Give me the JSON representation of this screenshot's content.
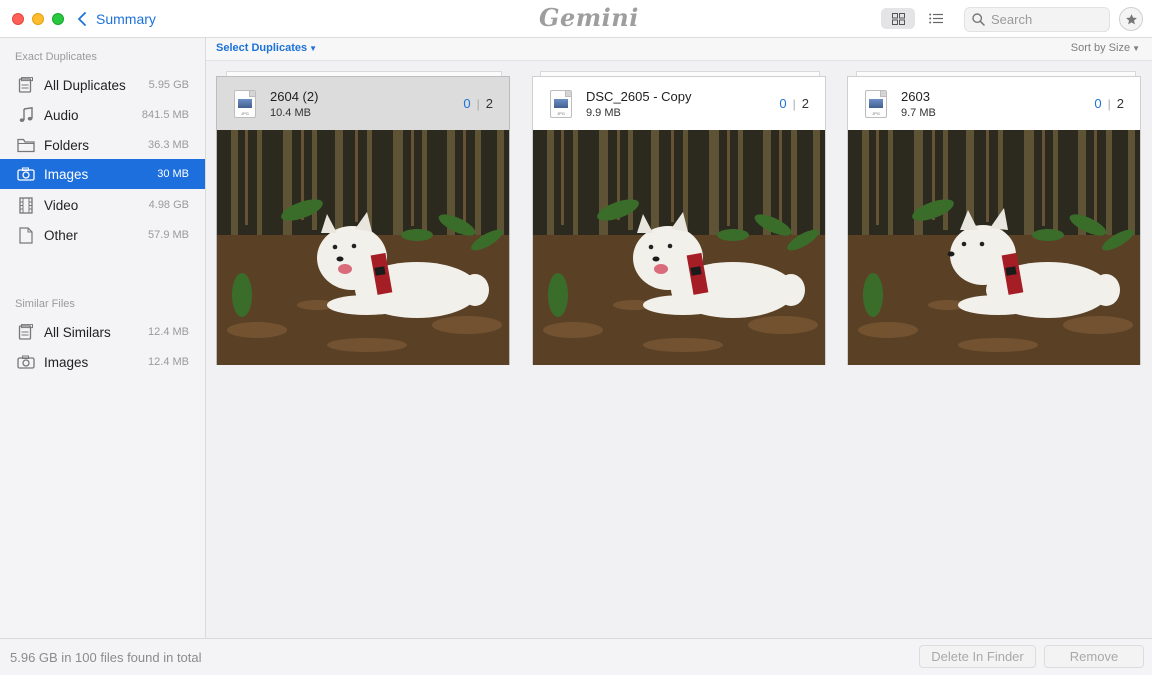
{
  "window": {
    "back_label": "Summary",
    "logo_text": "Gemini",
    "search_placeholder": "Search"
  },
  "sidebar": {
    "exact_title": "Exact Duplicates",
    "exact_items": [
      {
        "label": "All Duplicates",
        "size": "5.95 GB",
        "icon": "duplicates-icon"
      },
      {
        "label": "Audio",
        "size": "841.5 MB",
        "icon": "music-note-icon"
      },
      {
        "label": "Folders",
        "size": "36.3 MB",
        "icon": "folder-icon"
      },
      {
        "label": "Images",
        "size": "30 MB",
        "icon": "camera-icon",
        "active": true
      },
      {
        "label": "Video",
        "size": "4.98 GB",
        "icon": "film-icon"
      },
      {
        "label": "Other",
        "size": "57.9 MB",
        "icon": "document-icon"
      }
    ],
    "similar_title": "Similar Files",
    "similar_items": [
      {
        "label": "All Similars",
        "size": "12.4 MB",
        "icon": "duplicates-icon"
      },
      {
        "label": "Images",
        "size": "12.4 MB",
        "icon": "camera-icon"
      }
    ]
  },
  "toolbar": {
    "select_label": "Select Duplicates",
    "sort_label": "Sort by Size"
  },
  "cards": [
    {
      "name": "2604 (2)",
      "size": "10.4 MB",
      "selected_count": "0",
      "total_count": "2",
      "selected": true
    },
    {
      "name": "DSC_2605 - Copy",
      "size": "9.9 MB",
      "selected_count": "0",
      "total_count": "2",
      "selected": false
    },
    {
      "name": "2603",
      "size": "9.7 MB",
      "selected_count": "0",
      "total_count": "2",
      "selected": false
    }
  ],
  "footer": {
    "summary": "5.96 GB in 100 files found in total",
    "delete_label": "Delete In Finder",
    "remove_label": "Remove"
  },
  "colors": {
    "accent": "#1c6fdc",
    "link": "#1d72d8"
  }
}
